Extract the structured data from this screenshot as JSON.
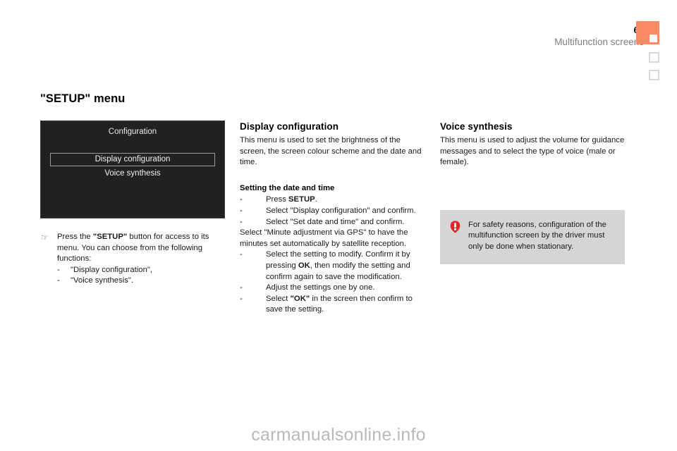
{
  "header": {
    "page_number": "69",
    "section_title": "Multifunction screens",
    "tabs": [
      {
        "name": "active-tab-marker",
        "state": "active"
      },
      {
        "name": "tab-marker-2",
        "state": "idle"
      },
      {
        "name": "tab-marker-3",
        "state": "idle"
      }
    ],
    "accent_color": "#fb8b62",
    "idle_marker_color": "#d8d8d8"
  },
  "page_title": "\"SETUP\" menu",
  "left_column": {
    "device_screen": {
      "title": "Configuration",
      "items": [
        {
          "label": "Display configuration",
          "selected": true
        },
        {
          "label": "Voice synthesis",
          "selected": false
        }
      ],
      "background_color": "#212121"
    },
    "instruction": {
      "icon": "pointing-hand-icon",
      "icon_glyph": "☞",
      "text_part_1": "Press the ",
      "text_bold": "\"SETUP\"",
      "text_part_2": " button for access to its menu. You can choose from the following functions:",
      "sub_items": [
        "\"Display configuration\",",
        "\"Voice synthesis\"."
      ]
    }
  },
  "middle_column": {
    "heading": "Display configuration",
    "intro": "This menu is used to set the brightness of the screen, the screen colour scheme and the date and time.",
    "sub_heading": "Setting the date and time",
    "steps_group_1": [
      {
        "pre": "Press ",
        "bold": "SETUP",
        "post": "."
      },
      {
        "pre": "Select \"Display configuration\" and confirm.",
        "bold": "",
        "post": ""
      },
      {
        "pre": "Select \"Set date and time\" and confirm.",
        "bold": "",
        "post": ""
      }
    ],
    "note": "Select \"Minute adjustment via GPS\" to have the minutes set automatically by satellite reception.",
    "steps_group_2": [
      {
        "pre": "Select the setting to modify. Confirm it by pressing ",
        "bold": "OK",
        "post": ", then modify the setting and confirm again to save the modification."
      },
      {
        "pre": "Adjust the settings one by one.",
        "bold": "",
        "post": ""
      },
      {
        "pre": "Select ",
        "bold": "\"OK\"",
        "post": " in the screen then confirm to save the setting."
      }
    ]
  },
  "right_column": {
    "heading": "Voice synthesis",
    "intro": "This menu is used to adjust the volume for guidance messages and to select the type of voice (male or female).",
    "warning": {
      "icon": "warning-exclamation-icon",
      "icon_color": "#ed2024",
      "background_color": "#d5d5d5",
      "text": "For safety reasons, configuration of the multifunction screen by the driver must only be done when stationary."
    }
  },
  "watermark": "carmanualsonline.info"
}
